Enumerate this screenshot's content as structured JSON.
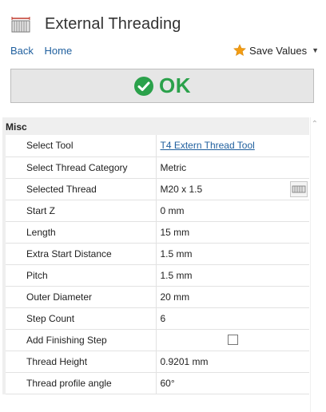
{
  "header": {
    "title": "External Threading",
    "icon": "thread-tool-icon"
  },
  "nav": {
    "back_label": "Back",
    "home_label": "Home"
  },
  "toolbar": {
    "save_values_label": "Save Values",
    "save_icon": "star-icon",
    "star_color": "#f39c12"
  },
  "ok_button": {
    "label": "OK",
    "icon": "check-circle-icon",
    "color": "#2ba14b"
  },
  "grid": {
    "section_label": "Misc",
    "rows": [
      {
        "name": "Select Tool",
        "value": "T4 Extern Thread Tool"
      },
      {
        "name": "Select Thread Category",
        "value": "Metric"
      },
      {
        "name": "Selected Thread",
        "value": "M20 x 1.5"
      },
      {
        "name": "Start Z",
        "value": "0 mm"
      },
      {
        "name": "Length",
        "value": "15 mm"
      },
      {
        "name": "Extra Start Distance",
        "value": "1.5 mm"
      },
      {
        "name": "Pitch",
        "value": "1.5 mm"
      },
      {
        "name": "Outer Diameter",
        "value": "20 mm"
      },
      {
        "name": "Step Count",
        "value": "6"
      },
      {
        "name": "Add Finishing Step",
        "value": "",
        "checked": false
      },
      {
        "name": "Thread Height",
        "value": "0.9201 mm"
      },
      {
        "name": "Thread profile angle",
        "value": "60°"
      }
    ]
  }
}
